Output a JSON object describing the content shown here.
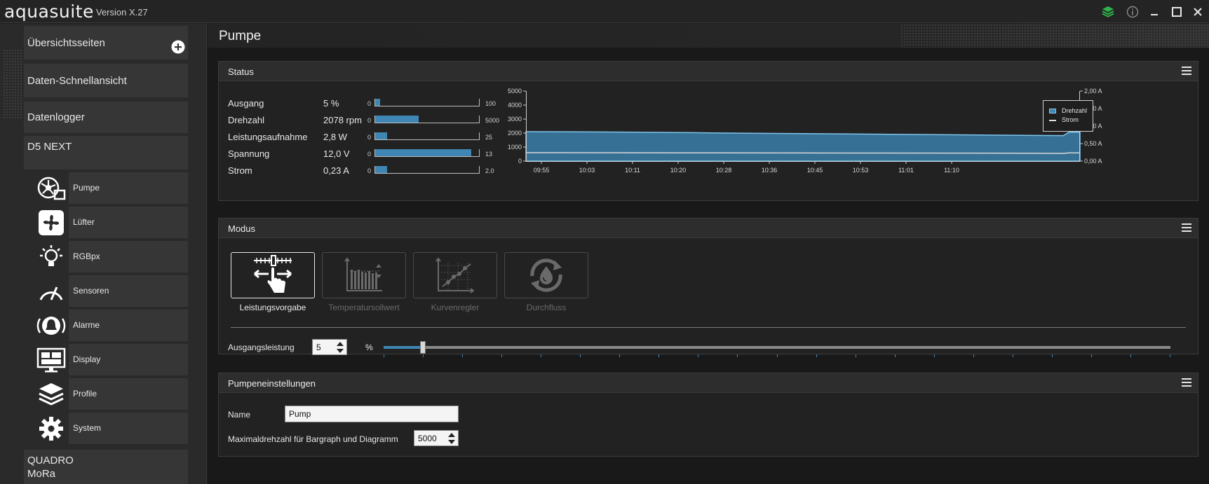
{
  "app": {
    "name": "aquasuite",
    "version": "Version X.27"
  },
  "sidebar": {
    "top_items": [
      {
        "label": "Übersichtsseiten"
      },
      {
        "label": "Daten-Schnellansicht"
      },
      {
        "label": "Datenlogger"
      },
      {
        "label": "D5 NEXT"
      }
    ],
    "sub_items": [
      {
        "label": "Pumpe",
        "icon": "pump-icon"
      },
      {
        "label": "Lüfter",
        "icon": "fan-icon"
      },
      {
        "label": "RGBpx",
        "icon": "lightbulb-icon"
      },
      {
        "label": "Sensoren",
        "icon": "gauge-icon"
      },
      {
        "label": "Alarme",
        "icon": "alarm-bell-icon"
      },
      {
        "label": "Display",
        "icon": "display-icon"
      },
      {
        "label": "Profile",
        "icon": "layers-icon"
      },
      {
        "label": "System",
        "icon": "gear-icon"
      }
    ],
    "bottom_item": {
      "line1": "QUADRO",
      "line2": "MoRa"
    }
  },
  "page": {
    "title": "Pumpe"
  },
  "status": {
    "title": "Status",
    "rows": [
      {
        "label": "Ausgang",
        "value": "5 %",
        "min": "0",
        "max": "100",
        "fill": 0.05
      },
      {
        "label": "Drehzahl",
        "value": "2078 rpm",
        "min": "0",
        "max": "5000",
        "fill": 0.4156
      },
      {
        "label": "Leistungsaufnahme",
        "value": "2,8 W",
        "min": "0",
        "max": "25",
        "fill": 0.112
      },
      {
        "label": "Spannung",
        "value": "12,0 V",
        "min": "0",
        "max": "13",
        "fill": 0.923
      },
      {
        "label": "Strom",
        "value": "0,23 A",
        "min": "0",
        "max": "2.0",
        "fill": 0.115
      }
    ]
  },
  "chart_data": {
    "type": "area",
    "categories": [
      "09:55",
      "10:03",
      "10:11",
      "10:20",
      "10:28",
      "10:36",
      "10:45",
      "10:53",
      "11:01",
      "11:10"
    ],
    "y_left_ticks": [
      "0",
      "1000",
      "2000",
      "3000",
      "4000",
      "5000"
    ],
    "y_right_ticks": [
      "0,00 A",
      "0,50 A",
      "1,00 A",
      "1,50 A",
      "2,00 A"
    ],
    "ylim_left": [
      0,
      5000
    ],
    "ylim_right": [
      0,
      2.0
    ],
    "legend_position": "right",
    "series": [
      {
        "name": "Drehzahl",
        "color": "#3f86b4",
        "points": [
          [
            0,
            2100
          ],
          [
            0.1,
            2090
          ],
          [
            0.2,
            2060
          ],
          [
            0.3,
            2030
          ],
          [
            0.4,
            1990
          ],
          [
            0.5,
            1960
          ],
          [
            0.6,
            1930
          ],
          [
            0.7,
            1900
          ],
          [
            0.8,
            1870
          ],
          [
            0.9,
            1840
          ],
          [
            0.97,
            1820
          ],
          [
            0.98,
            2060
          ],
          [
            1.0,
            2070
          ]
        ]
      },
      {
        "name": "Strom",
        "color": "#e0e0e0",
        "points": [
          [
            0,
            0.24
          ],
          [
            0.3,
            0.235
          ],
          [
            0.6,
            0.23
          ],
          [
            0.9,
            0.225
          ],
          [
            0.97,
            0.22
          ],
          [
            0.98,
            0.235
          ],
          [
            1.0,
            0.235
          ]
        ]
      }
    ]
  },
  "modus": {
    "title": "Modus",
    "buttons": [
      {
        "label": "Leistungsvorgabe",
        "active": true,
        "icon": "power-preset-icon"
      },
      {
        "label": "Temperatursollwert",
        "active": false,
        "icon": "temperature-setpoint-icon"
      },
      {
        "label": "Kurvenregler",
        "active": false,
        "icon": "curve-controller-icon"
      },
      {
        "label": "Durchfluss",
        "active": false,
        "icon": "flow-icon"
      }
    ],
    "output_label": "Ausgangsleistung",
    "output_value": "5",
    "unit": "%",
    "slider_fraction": 0.05
  },
  "pump_settings": {
    "title": "Pumpeneinstellungen",
    "name_label": "Name",
    "name_value": "Pump",
    "max_label": "Maximaldrehzahl für Bargraph und Diagramm",
    "max_value": "5000"
  }
}
